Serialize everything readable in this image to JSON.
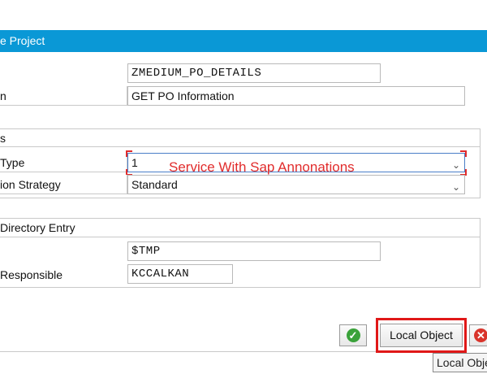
{
  "window": {
    "title": "e Project"
  },
  "form": {
    "project_label": "",
    "project_value": "ZMEDIUM_PO_DETAILS",
    "description_label": "n",
    "description_value": "GET PO Information"
  },
  "attributes": {
    "group_title": "s",
    "type_label": "Type",
    "type_value": "1",
    "strategy_label": "ion Strategy",
    "strategy_value": "Standard"
  },
  "directory": {
    "group_title": "Directory Entry",
    "package_label": "",
    "package_value": "$TMP",
    "responsible_label": "Responsible",
    "responsible_value": "KCCALKAN"
  },
  "annotation": {
    "text": "Service With Sap Annonations",
    "color": "#e12c2c"
  },
  "buttons": {
    "continue_icon": "green-check-icon",
    "local_object_label": "Local Object",
    "cancel_icon": "red-cancel-icon"
  },
  "tooltip": {
    "text": "Local Obje"
  },
  "colors": {
    "title_bar": "#0a98d6",
    "highlight": "#e01818"
  }
}
